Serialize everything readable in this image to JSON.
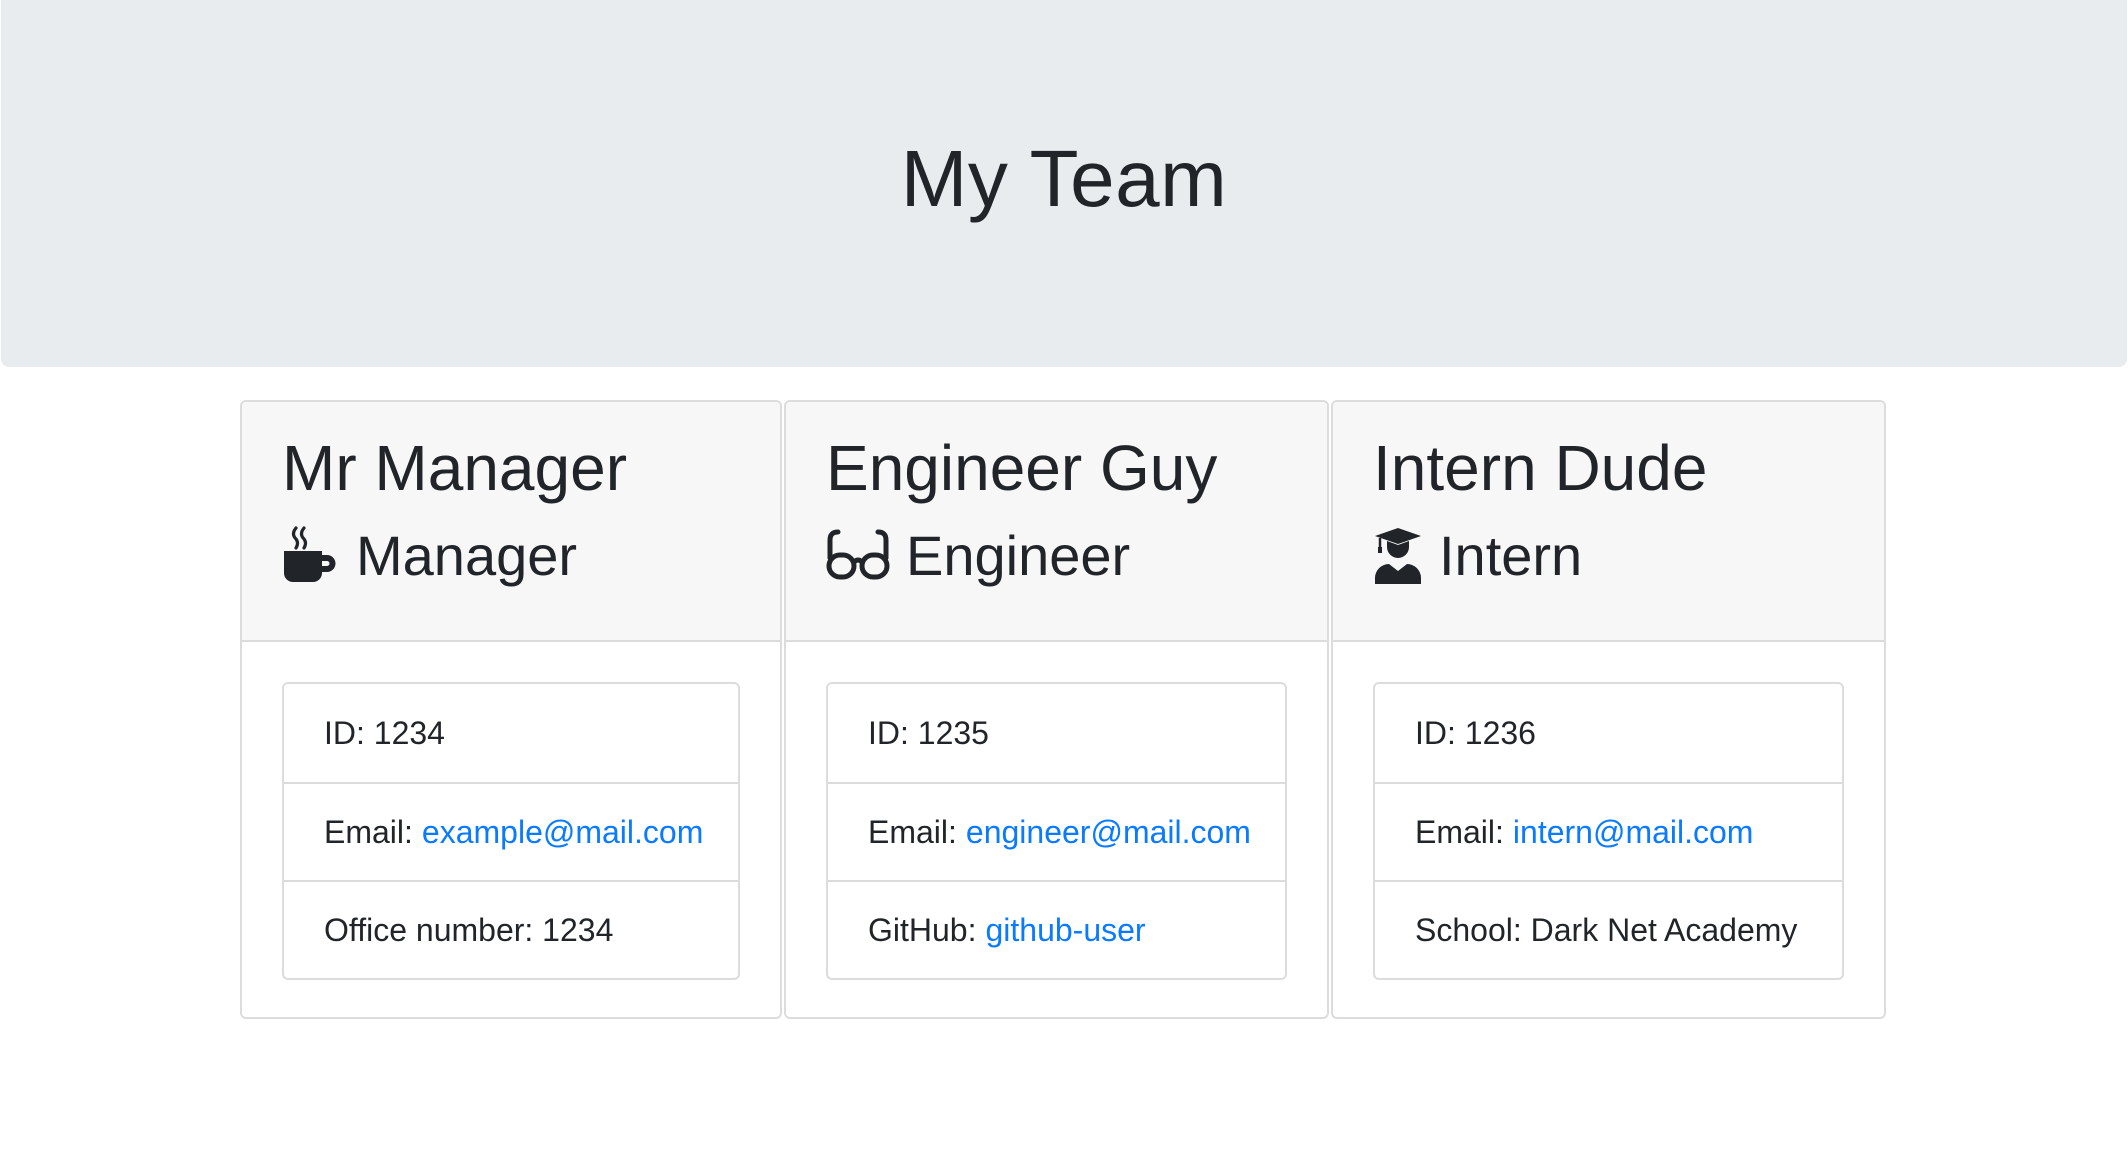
{
  "header": {
    "title": "My Team"
  },
  "colors": {
    "link": "#0a7bff",
    "jumbotron": "#e9ecef",
    "card_header": "#f7f7f7"
  },
  "cards": [
    {
      "name": "Mr Manager",
      "role": "Manager",
      "icon": "mug-hot-icon",
      "id_text": "ID: 1234",
      "email_label": "Email:",
      "email": "example@mail.com",
      "extra_text": "Office number: 1234"
    },
    {
      "name": "Engineer Guy",
      "role": "Engineer",
      "icon": "glasses-icon",
      "id_text": "ID: 1235",
      "email_label": "Email:",
      "email": "engineer@mail.com",
      "extra_label": "GitHub:",
      "extra_link": "github-user"
    },
    {
      "name": "Intern Dude",
      "role": "Intern",
      "icon": "user-graduate-icon",
      "id_text": "ID: 1236",
      "email_label": "Email:",
      "email": "intern@mail.com",
      "extra_text": "School: Dark Net Academy"
    }
  ]
}
